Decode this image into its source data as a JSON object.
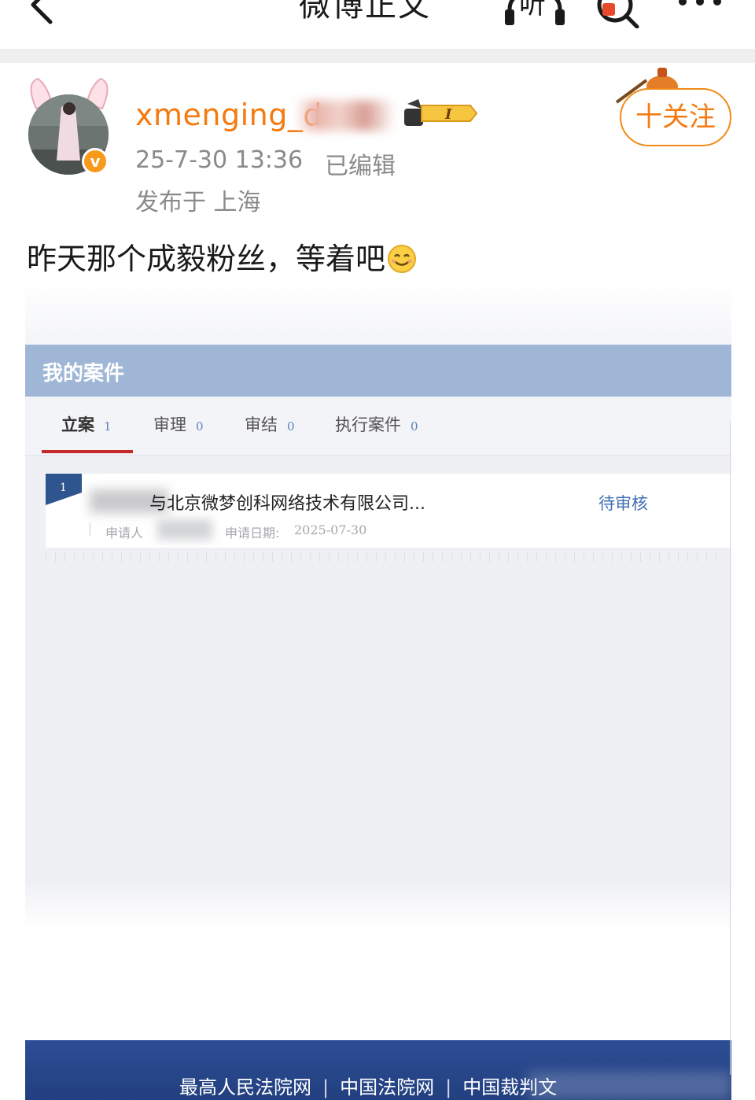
{
  "nav": {
    "title": "微博正文",
    "listen_label": "听",
    "back_icon": "chevron-left-icon",
    "search_icon": "search-icon",
    "more_icon": "more-dots-icon"
  },
  "post": {
    "username": "xmenging_d",
    "verified_mark": "v",
    "vip_level": "I",
    "time": "25-7-30 13:36",
    "edited_label": "已编辑",
    "location": "发布于 上海",
    "follow_label": "十关注",
    "text": "昨天那个成毅粉丝，等着吧"
  },
  "case_screenshot": {
    "header_title": "我的案件",
    "tabs": [
      {
        "label": "立案",
        "count": "1",
        "active": true
      },
      {
        "label": "审理",
        "count": "0",
        "active": false
      },
      {
        "label": "审结",
        "count": "0",
        "active": false
      },
      {
        "label": "执行案件",
        "count": "0",
        "active": false
      }
    ],
    "case": {
      "index": "1",
      "name": "与北京微梦创科网络技术有限公司...",
      "status": "待审核",
      "applicant_label": "申请人",
      "date_label": "申请日期:",
      "date_value": "2025-07-30"
    },
    "footer_links": [
      "最高人民法院网",
      "中国法院网",
      "中国裁判文"
    ]
  },
  "colors": {
    "accent_orange": "#f47b10",
    "case_header_blue": "#9fb6d6",
    "footer_navy": "#2d4d95",
    "tab_underline_red": "#c52a2a",
    "status_blue": "#3f6fb3"
  }
}
